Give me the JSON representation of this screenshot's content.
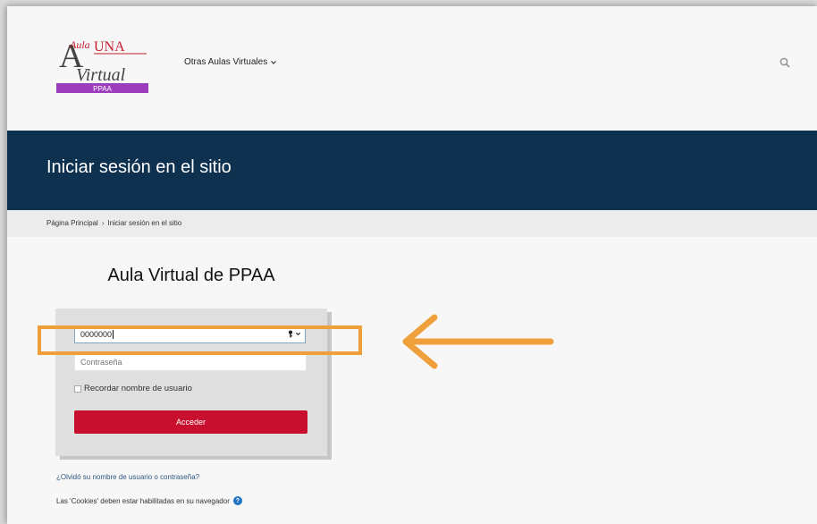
{
  "header": {
    "logo": {
      "line1": "Aula",
      "brand": "UNA",
      "line2": "Virtual",
      "badge": "PPAA",
      "colors": {
        "red": "#c41c2c",
        "purple": "#9b3dbd",
        "gray": "#444444"
      }
    },
    "nav_label": "Otras Aulas Virtuales",
    "search_icon": "search-icon"
  },
  "banner": {
    "title": "Iniciar sesión en el sitio",
    "color": "#0e3150"
  },
  "breadcrumb": {
    "home": "Página Principal",
    "separator": "›",
    "current": "Iniciar sesión en el sitio"
  },
  "login": {
    "site_name": "Aula Virtual de PPAA",
    "username_value": "0000000",
    "password_placeholder": "Contraseña",
    "remember_label": "Recordar nombre de usuario",
    "submit_label": "Acceder",
    "submit_color": "#c8102e",
    "forgot_link": "¿Olvidó su nombre de usuario o contraseña?",
    "cookies_note": "Las 'Cookies' deben estar habilitadas en su navegador",
    "help_icon": "?"
  },
  "annotation": {
    "color": "#f0a03a",
    "icons": [
      "highlight-box",
      "arrow-left-icon"
    ]
  }
}
